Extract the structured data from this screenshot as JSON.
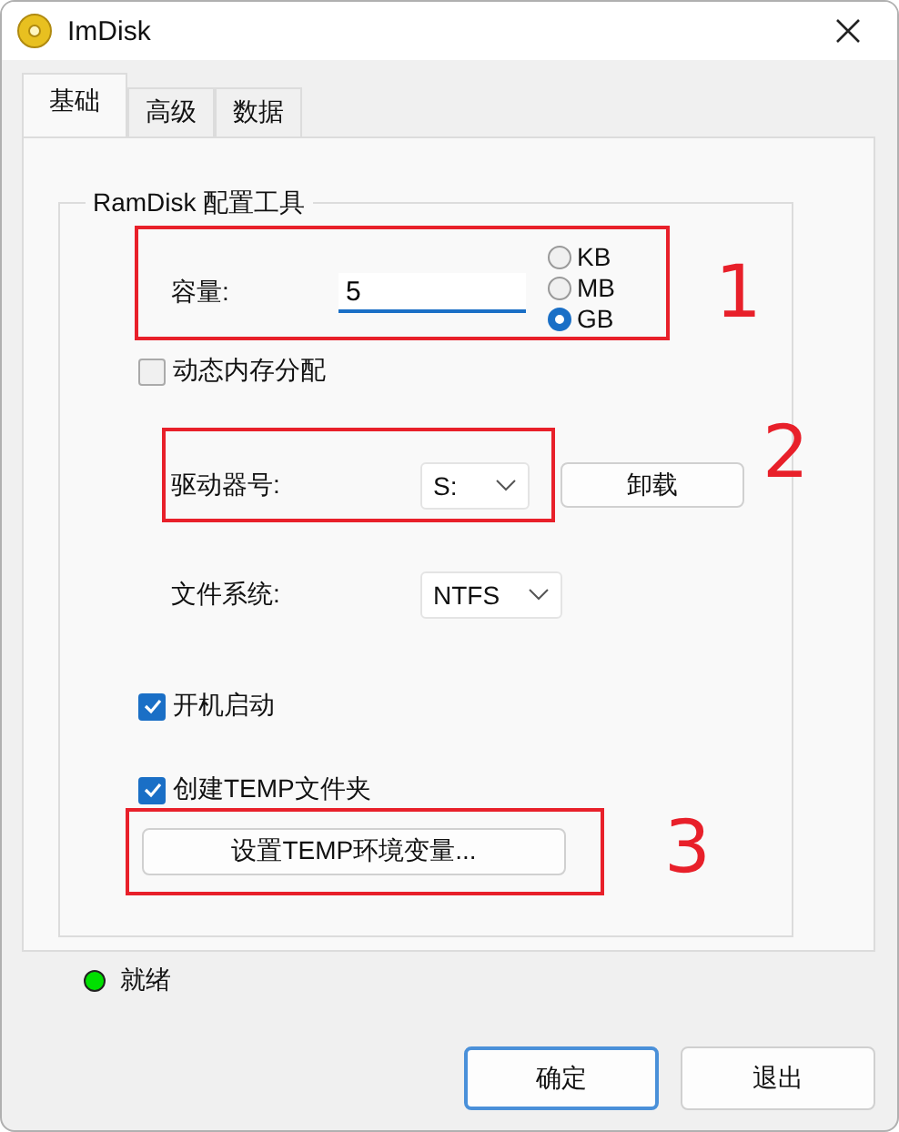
{
  "window": {
    "title": "ImDisk"
  },
  "tabs": [
    {
      "label": "基础",
      "selected": true
    },
    {
      "label": "高级",
      "selected": false
    },
    {
      "label": "数据",
      "selected": false
    }
  ],
  "group": {
    "title": "RamDisk 配置工具"
  },
  "capacity": {
    "label": "容量:",
    "value": "5",
    "units": [
      {
        "label": "KB",
        "selected": false
      },
      {
        "label": "MB",
        "selected": false
      },
      {
        "label": "GB",
        "selected": true
      }
    ]
  },
  "dynamic_memory": {
    "label": "动态内存分配",
    "checked": false
  },
  "drive": {
    "label": "驱动器号:",
    "value": "S:",
    "button": "卸载"
  },
  "filesystem": {
    "label": "文件系统:",
    "value": "NTFS"
  },
  "autostart": {
    "label": "开机启动",
    "checked": true
  },
  "create_temp": {
    "label": "创建TEMP文件夹",
    "checked": true
  },
  "temp_button": "设置TEMP环境变量...",
  "status": {
    "text": "就绪"
  },
  "buttons": [
    {
      "label": "确定",
      "default": true
    },
    {
      "label": "退出",
      "default": false
    }
  ],
  "annotations": [
    {
      "label": "1"
    },
    {
      "label": "2"
    },
    {
      "label": "3"
    }
  ]
}
